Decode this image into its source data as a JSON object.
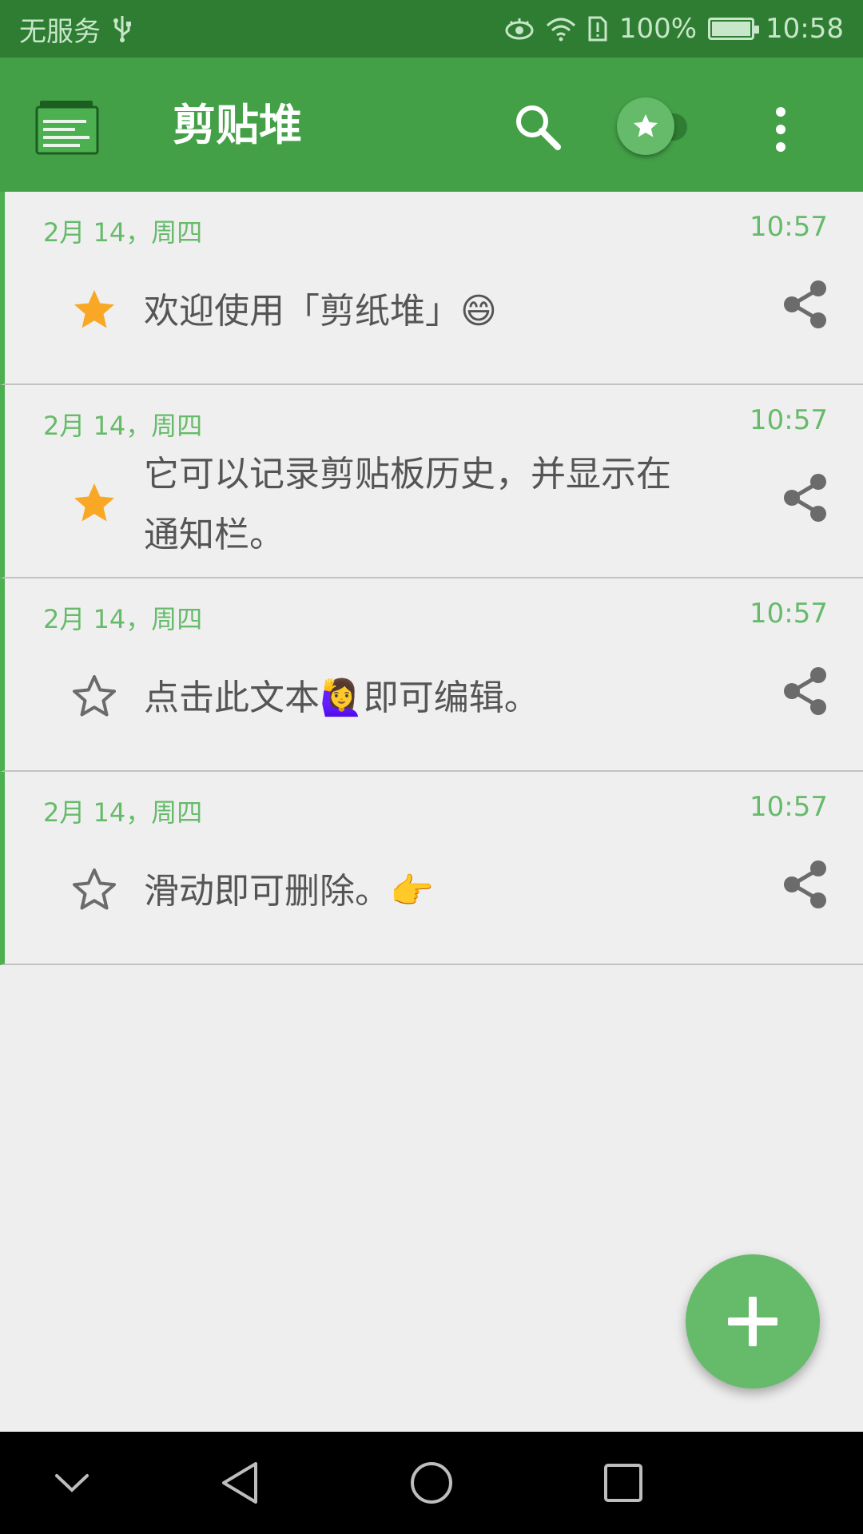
{
  "status_bar": {
    "carrier": "无服务",
    "battery_text": "100%",
    "battery_level": 1.0,
    "time": "10:58",
    "icons": [
      "usb-icon",
      "eye-icon",
      "wifi-icon",
      "sim-alert-icon",
      "battery-charging-icon"
    ]
  },
  "app_bar": {
    "title": "剪贴堆",
    "icons": [
      "app-logo-icon",
      "search-icon",
      "star-filter-toggle",
      "more-vert-icon"
    ],
    "star_filter_on": true
  },
  "clips": [
    {
      "date": "2月 14，周四",
      "time": "10:57",
      "text": "欢迎使用「剪纸堆」😄",
      "starred": true
    },
    {
      "date": "2月 14，周四",
      "time": "10:57",
      "text": "它可以记录剪贴板历史，并显示在通知栏。",
      "starred": true
    },
    {
      "date": "2月 14，周四",
      "time": "10:57",
      "text": "点击此文本🙋‍♀️即可编辑。",
      "starred": false
    },
    {
      "date": "2月 14，周四",
      "time": "10:57",
      "text": "滑动即可删除。👉",
      "starred": false
    }
  ],
  "fab": {
    "icon": "plus-icon"
  },
  "nav_bar": {
    "icons": [
      "chevron-down-icon",
      "back-icon",
      "home-icon",
      "recents-icon"
    ]
  },
  "colors": {
    "status_bar": "#2e7d32",
    "app_bar": "#43a047",
    "accent": "#66bb6a",
    "star_filled": "#f9a825",
    "background": "#eeeeee"
  }
}
